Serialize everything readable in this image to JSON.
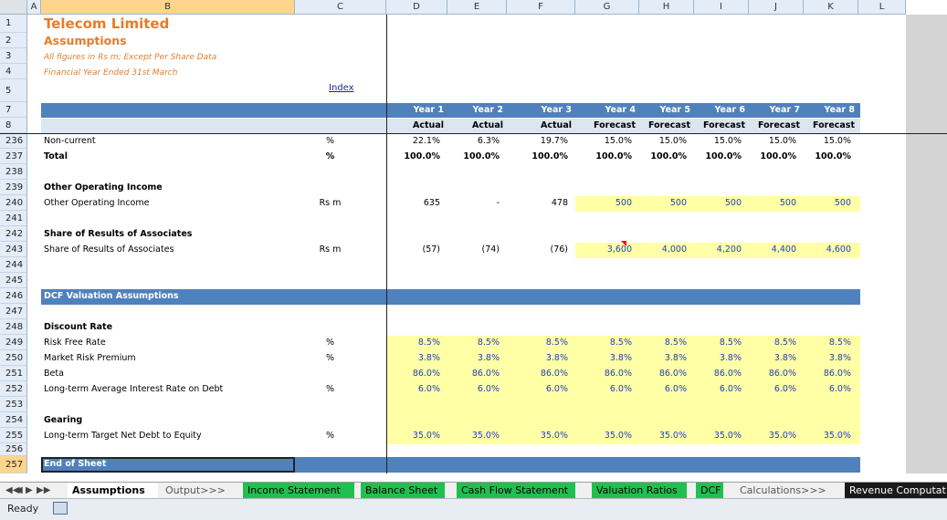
{
  "columns": [
    "A",
    "B",
    "C",
    "D",
    "E",
    "F",
    "G",
    "H",
    "I",
    "J",
    "K",
    "L"
  ],
  "rows": [
    "1",
    "2",
    "3",
    "4",
    "5",
    "7",
    "8",
    "236",
    "237",
    "238",
    "239",
    "240",
    "241",
    "242",
    "243",
    "244",
    "245",
    "246",
    "247",
    "248",
    "249",
    "250",
    "251",
    "252",
    "253",
    "254",
    "255",
    "256",
    "257"
  ],
  "title": {
    "company": "Telecom Limited",
    "sheet": "Assumptions",
    "note1": "All figures in Rs m; Except Per Share Data",
    "note2": "Financial Year Ended 31st March",
    "index": "Index"
  },
  "years": [
    "Year 1",
    "Year 2",
    "Year 3",
    "Year 4",
    "Year 5",
    "Year 6",
    "Year 7",
    "Year 8"
  ],
  "types": [
    "Actual",
    "Actual",
    "Actual",
    "Forecast",
    "Forecast",
    "Forecast",
    "Forecast",
    "Forecast"
  ],
  "rows_data": {
    "noncurrent": {
      "label": "Non-current",
      "unit": "%",
      "values": [
        "22.1%",
        "6.3%",
        "19.7%",
        "15.0%",
        "15.0%",
        "15.0%",
        "15.0%",
        "15.0%"
      ]
    },
    "total": {
      "label": "Total",
      "unit": "%",
      "values": [
        "100.0%",
        "100.0%",
        "100.0%",
        "100.0%",
        "100.0%",
        "100.0%",
        "100.0%",
        "100.0%"
      ]
    },
    "ooi_head": {
      "label": "Other Operating Income"
    },
    "ooi": {
      "label": "Other Operating Income",
      "unit": "Rs m",
      "values": [
        "635",
        "-",
        "478",
        "500",
        "500",
        "500",
        "500",
        "500"
      ]
    },
    "sra_head": {
      "label": "Share of Results of Associates"
    },
    "sra": {
      "label": "Share of Results of Associates",
      "unit": "Rs m",
      "values": [
        "(57)",
        "(74)",
        "(76)",
        "3,600",
        "4,000",
        "4,200",
        "4,400",
        "4,600"
      ]
    },
    "dcf_head": {
      "label": "DCF Valuation Assumptions"
    },
    "dr_head": {
      "label": "Discount Rate"
    },
    "rfr": {
      "label": "Risk Free Rate",
      "unit": "%",
      "values": [
        "8.5%",
        "8.5%",
        "8.5%",
        "8.5%",
        "8.5%",
        "8.5%",
        "8.5%",
        "8.5%"
      ]
    },
    "mrp": {
      "label": "Market Risk Premium",
      "unit": "%",
      "values": [
        "3.8%",
        "3.8%",
        "3.8%",
        "3.8%",
        "3.8%",
        "3.8%",
        "3.8%",
        "3.8%"
      ]
    },
    "beta": {
      "label": "Beta",
      "unit": "",
      "values": [
        "86.0%",
        "86.0%",
        "86.0%",
        "86.0%",
        "86.0%",
        "86.0%",
        "86.0%",
        "86.0%"
      ]
    },
    "ltir": {
      "label": "Long-term Average Interest Rate on Debt",
      "unit": "%",
      "values": [
        "6.0%",
        "6.0%",
        "6.0%",
        "6.0%",
        "6.0%",
        "6.0%",
        "6.0%",
        "6.0%"
      ]
    },
    "gear_head": {
      "label": "Gearing"
    },
    "gear": {
      "label": "Long-term Target Net Debt to Equity",
      "unit": "%",
      "values": [
        "35.0%",
        "35.0%",
        "35.0%",
        "35.0%",
        "35.0%",
        "35.0%",
        "35.0%",
        "35.0%"
      ]
    },
    "end": {
      "label": "End of Sheet"
    }
  },
  "tabs": [
    "Assumptions",
    "Output>>>",
    "Income Statement",
    "Balance Sheet",
    "Cash Flow Statement",
    "Valuation Ratios",
    "DCF",
    "Calculations>>>",
    "Revenue Computat"
  ],
  "nav": [
    "◀◀",
    "◀",
    "▶",
    "▶▶"
  ],
  "status": {
    "ready": "Ready"
  },
  "icons": {
    "status_macro": "macro-record-icon"
  },
  "colors": {
    "band": "#4f81bd",
    "input_fill": "#ffffa6",
    "title": "#e47c2b",
    "tab_green": "#20c050"
  }
}
